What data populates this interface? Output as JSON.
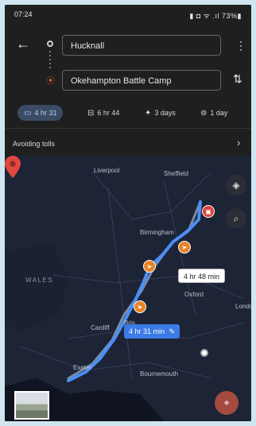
{
  "status_bar": {
    "time": "07:24",
    "indicators": "▮ ◘ ᯤ .ıl 73%▮"
  },
  "nav": {
    "back_icon": "arrow-left-icon",
    "more_icon": "kebab-icon",
    "swap_icon": "swap-icon"
  },
  "origin": {
    "value": "Hucknall"
  },
  "destination": {
    "value": "Okehampton Battle Camp"
  },
  "modes": [
    {
      "icon": "car-icon",
      "glyph": "▭",
      "label": "4 hr 31",
      "active": true
    },
    {
      "icon": "train-icon",
      "glyph": "⊟",
      "label": "6 hr 44",
      "active": false
    },
    {
      "icon": "walk-icon",
      "glyph": "🚶",
      "label": "3 days",
      "active": false
    },
    {
      "icon": "bike-icon",
      "glyph": "🚲",
      "label": "1 day",
      "active": false
    }
  ],
  "options": {
    "avoiding_label": "Avoiding tolls",
    "chevron": "›"
  },
  "map": {
    "places": {
      "liverpool": "Liverpool",
      "sheffield": "Sheffield",
      "birmingham": "Birmingham",
      "wales": "WALES",
      "oxford": "Oxford",
      "london": "Londo",
      "cardiff": "Cardiff",
      "bournemouth": "Bournemouth",
      "exeter": "Exeter",
      "bristol": "Bris"
    },
    "callouts": {
      "alternative": "4 hr 48 min",
      "main": "4 hr 31 min"
    },
    "colors": {
      "route": "#4b8ef5",
      "alt_route": "#7a8aa8",
      "map_bg": "#141a2a"
    }
  }
}
